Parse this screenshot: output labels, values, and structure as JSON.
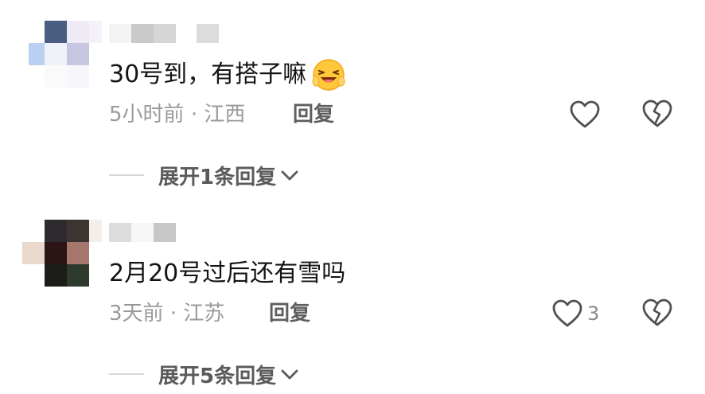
{
  "comments": [
    {
      "text": "30号到，有搭子嘛",
      "emoji": "grinning-squinting-face-emoji",
      "time": "5小时前",
      "separator": "·",
      "location": "江西",
      "reply_label": "回复",
      "like_count": "",
      "expand_label": "展开1条回复",
      "avatar_colors": [
        "#4a5e82",
        "#eeeaf6",
        "#f4f1f9",
        "#b9d0f2",
        "#eef1f7",
        "#c6c6e2",
        "#fafafa",
        "#f7f7fb",
        "#f9f9fb"
      ]
    },
    {
      "text": "2月20号过后还有雪吗",
      "emoji": "",
      "time": "3天前",
      "separator": "·",
      "location": "江苏",
      "reply_label": "回复",
      "like_count": "3",
      "expand_label": "展开5条回复",
      "avatar_colors": [
        "#2e2b2e",
        "#3c3431",
        "#f3eeea",
        "#2a1414",
        "#a6776c",
        "#e9d8cc",
        "#1c1c18",
        "#2e3a2c",
        "#f1f1f1"
      ]
    }
  ],
  "icons": {
    "like": "heart-outline-icon",
    "dislike": "broken-heart-outline-icon",
    "expand": "chevron-down-icon"
  },
  "colors": {
    "text_primary": "#141414",
    "text_secondary": "#9a9a9a",
    "icon": "#505050"
  }
}
